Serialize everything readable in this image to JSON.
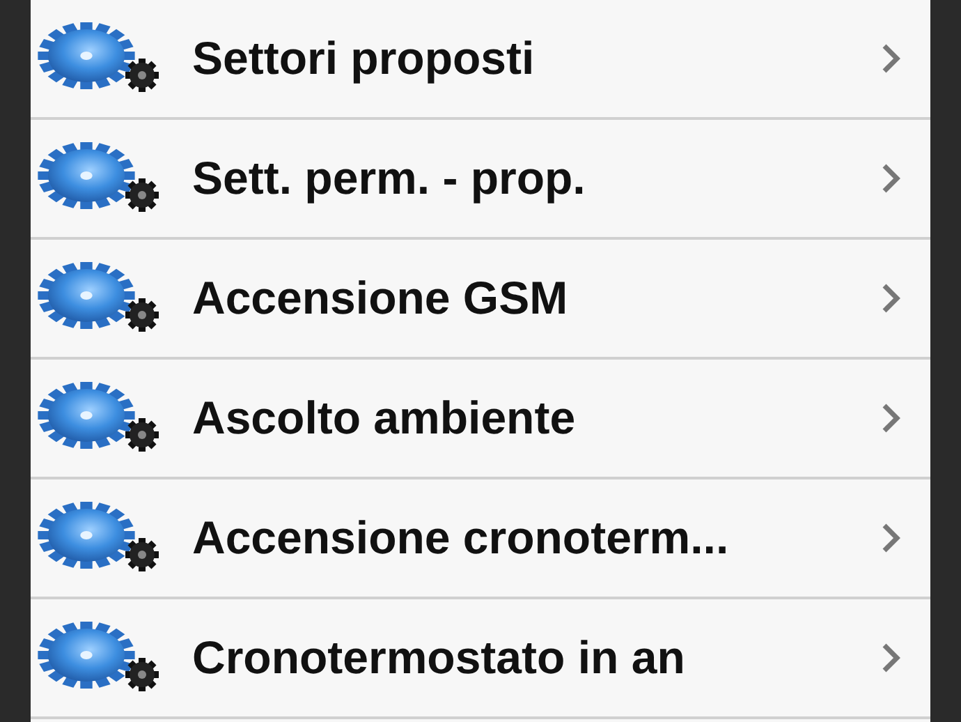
{
  "menu": [
    {
      "label": "Settori proposti"
    },
    {
      "label": "Sett. perm. - prop."
    },
    {
      "label": "Accensione GSM"
    },
    {
      "label": "Ascolto ambiente"
    },
    {
      "label": "Accensione cronoterm..."
    },
    {
      "label": "Cronotermostato in an"
    }
  ]
}
